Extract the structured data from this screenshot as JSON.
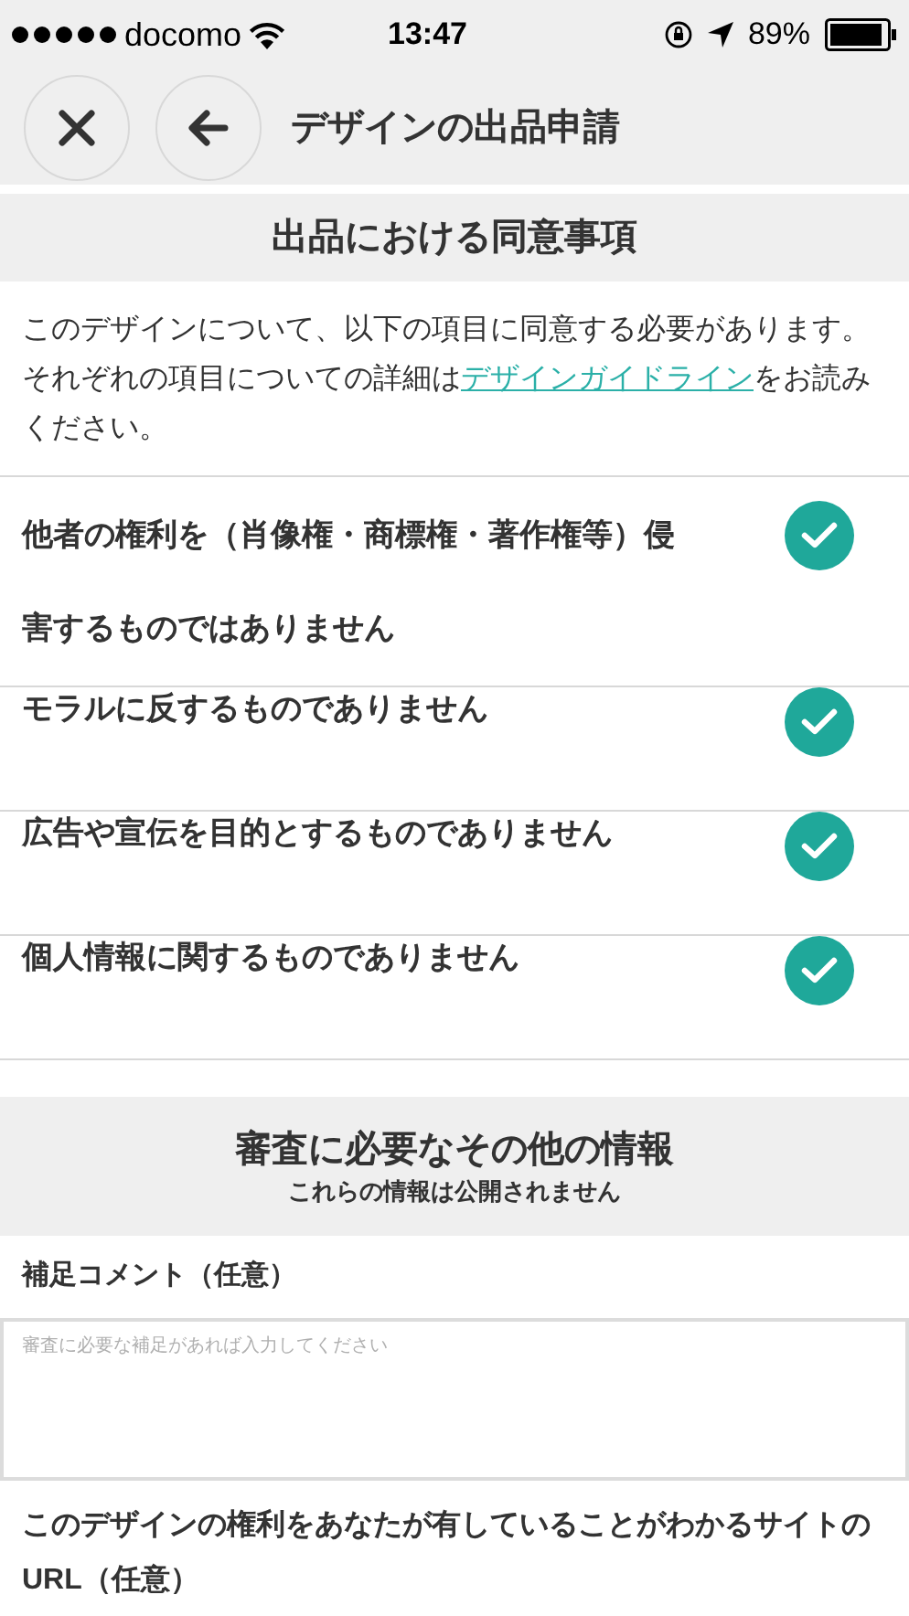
{
  "status_bar": {
    "carrier": "docomo",
    "time": "13:47",
    "battery": "89%"
  },
  "header": {
    "title": "デザインの出品申請"
  },
  "agreement": {
    "title": "出品における同意事項",
    "intro": {
      "before": "このデザインについて、以下の項目に同意する必要があります。それぞれの項目についての詳細は",
      "link": "デザインガイドライン",
      "after": "をお読みください。"
    },
    "items": [
      {
        "label": "他者の権利を（肖像権・商標権・著作権等）侵害するものではありません",
        "checked": true
      },
      {
        "label": "モラルに反するものでありません",
        "checked": true
      },
      {
        "label": "広告や宣伝を目的とするものでありません",
        "checked": true
      },
      {
        "label": "個人情報に関するものでありません",
        "checked": true
      }
    ]
  },
  "other_info": {
    "title": "審査に必要なその他の情報",
    "subtitle": "これらの情報は公開されません",
    "comment": {
      "label": "補足コメント（任意）",
      "placeholder": "審査に必要な補足があれば入力してください"
    },
    "url": {
      "label": "このデザインの権利をあなたが有していることがわかるサイトのURL（任意）"
    }
  }
}
